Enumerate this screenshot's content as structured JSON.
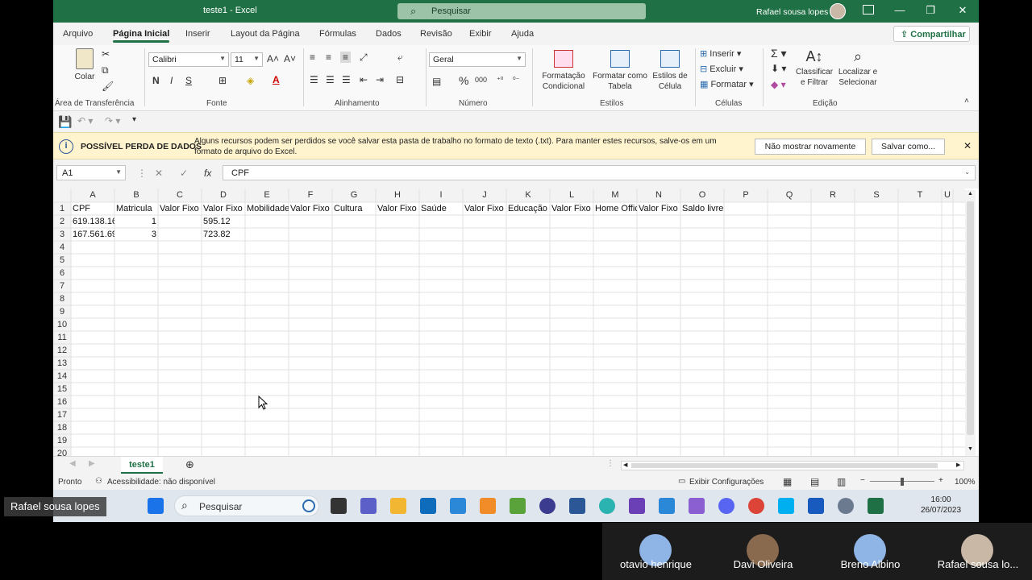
{
  "window": {
    "title": "teste1  -  Excel",
    "search_placeholder": "Pesquisar",
    "user": "Rafael sousa lopes"
  },
  "tabs": [
    {
      "label": "Arquivo"
    },
    {
      "label": "Página Inicial"
    },
    {
      "label": "Inserir"
    },
    {
      "label": "Layout da Página"
    },
    {
      "label": "Fórmulas"
    },
    {
      "label": "Dados"
    },
    {
      "label": "Revisão"
    },
    {
      "label": "Exibir"
    },
    {
      "label": "Ajuda"
    }
  ],
  "share_label": "Compartilhar",
  "ribbon": {
    "clipboard": {
      "paste": "Colar",
      "label": "Área de Transferência"
    },
    "font": {
      "name": "Calibri",
      "size": "11",
      "bold": "N",
      "italic": "I",
      "underline": "S",
      "label": "Fonte"
    },
    "alignment": {
      "label": "Alinhamento"
    },
    "number": {
      "format": "Geral",
      "label": "Número"
    },
    "styles": {
      "conditional": "Formatação Condicional",
      "table": "Formatar como Tabela",
      "cell_styles": "Estilos de Célula",
      "label": "Estilos"
    },
    "cells": {
      "insert": "Inserir",
      "delete": "Excluir",
      "format": "Formatar",
      "label": "Células"
    },
    "editing": {
      "sort": "Classificar e Filtrar",
      "find": "Localizar e Selecionar",
      "label": "Edição"
    }
  },
  "message_bar": {
    "heading": "POSSÍVEL PERDA DE DADOS",
    "text": "Alguns recursos podem ser perdidos se você salvar esta pasta de trabalho no formato de texto (.txt). Para manter estes recursos, salve-os em um formato de arquivo do Excel.",
    "dont_show": "Não mostrar novamente",
    "save_as": "Salvar como..."
  },
  "formula_bar": {
    "name_box": "A1",
    "fx": "fx",
    "content": "CPF"
  },
  "grid": {
    "columns": [
      "A",
      "B",
      "C",
      "D",
      "E",
      "F",
      "G",
      "H",
      "I",
      "J",
      "K",
      "L",
      "M",
      "N",
      "O",
      "P",
      "Q",
      "R",
      "S",
      "T",
      "U"
    ],
    "rows": [
      "1",
      "2",
      "3",
      "4",
      "5",
      "6",
      "7",
      "8",
      "9",
      "10",
      "11",
      "12",
      "13",
      "14",
      "15",
      "16",
      "17",
      "18",
      "19",
      "20"
    ],
    "header_row": [
      "CPF",
      "Matricula",
      "Valor Fixo",
      "Valor Fixo",
      "Mobilidade",
      "Valor Fixo",
      "Cultura",
      "Valor Fixo",
      "Saúde",
      "Valor Fixo",
      "Educação",
      "Valor Fixo",
      "Home Office",
      "Valor Fixo",
      "Saldo livre"
    ],
    "data_rows": [
      {
        "A": "619.138.16",
        "B": "1",
        "D": "595.12"
      },
      {
        "A": "167.561.69",
        "B": "3",
        "D": "723.82"
      }
    ]
  },
  "sheet_tab": "teste1",
  "status": {
    "ready": "Pronto",
    "accessibility": "Acessibilidade: não disponível",
    "display_settings": "Exibir Configurações",
    "zoom": "100%"
  },
  "taskbar": {
    "search": "Pesquisar",
    "time": "16:00",
    "date": "26/07/2023"
  },
  "participants": {
    "self": "Rafael sousa lopes",
    "tiles": [
      {
        "name": "otavio henrique"
      },
      {
        "name": "Davi Oliveira"
      },
      {
        "name": "Breno Albino"
      },
      {
        "name": "Rafael sousa lo..."
      }
    ]
  },
  "colors": {
    "excel_green": "#1f7145",
    "message_bar": "#fff4ce",
    "taskbar": "#dfe6ee"
  }
}
